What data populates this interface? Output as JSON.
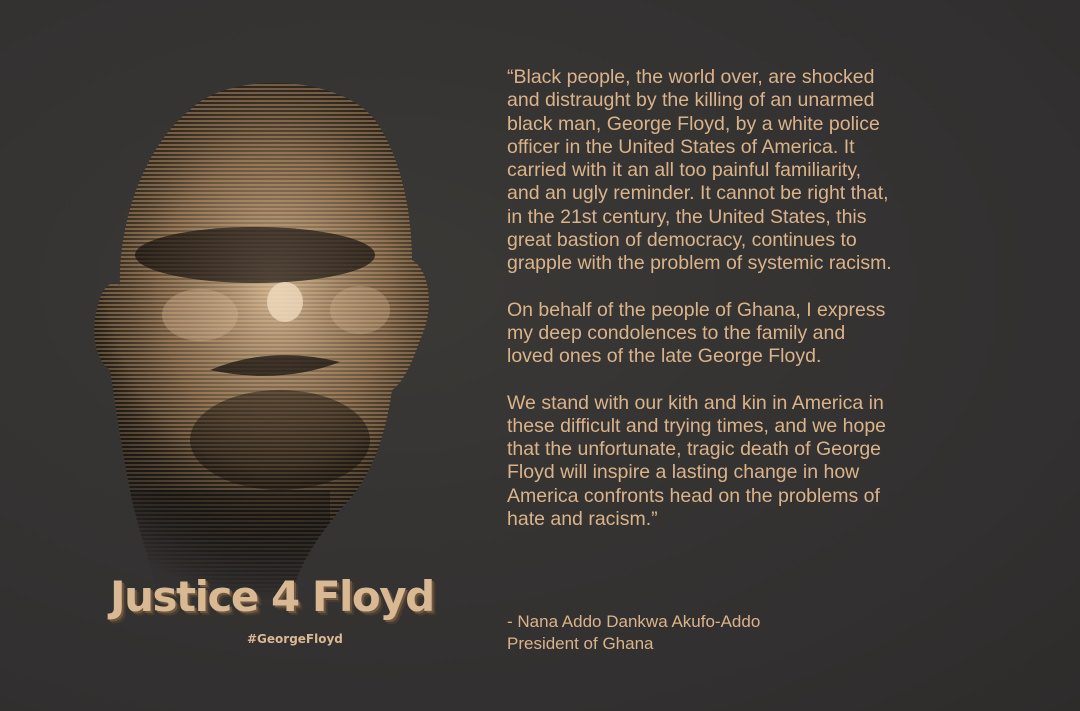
{
  "poster": {
    "headline": "Justice 4 Floyd",
    "hashtag": "#GeorgeFloyd",
    "quote": {
      "paragraphs": [
        "“Black people, the world over, are shocked\nand distraught by the killing of an unarmed\nblack man, George Floyd, by a white police\nofficer in the United States of America. It\ncarried with it an all too painful familiarity,\nand an ugly reminder. It cannot be right that,\nin the 21st century, the United States, this\ngreat bastion of democracy, continues to\ngrapple with the problem of systemic racism.",
        " On behalf of the people of Ghana, I express\nmy deep condolences to the family and\nloved ones of the late George Floyd.",
        " We stand with our kith and kin in America in\nthese difficult and trying times, and we hope\nthat the unfortunate, tragic death of George\nFloyd will inspire a lasting change in how\nAmerica confronts head on the problems of\nhate and racism.”"
      ]
    },
    "attribution": {
      "name": "- Nana Addo Dankwa Akufo-Addo",
      "title": "President of Ghana"
    }
  },
  "colors": {
    "background": "#353331",
    "accent": "#dbb38a"
  }
}
